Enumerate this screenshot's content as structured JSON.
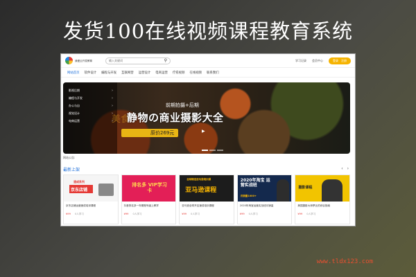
{
  "headline": "发货100在线视频课程教育系统",
  "header": {
    "logo_text": "我爱云开发教育",
    "search_placeholder": "输入关键词",
    "links": [
      "学习记录",
      "会员中心"
    ],
    "pill_buttons": [
      "登录",
      "注册"
    ]
  },
  "nav": {
    "items": [
      "网站首页",
      "软件设计",
      "编程与开发",
      "互联网营",
      "运营设计",
      "电商运营",
      "疗愈视频",
      "在线视频",
      "联系我们"
    ]
  },
  "banner": {
    "categories": [
      "影视后期",
      "编程与开发",
      "办公与自",
      "视觉设计",
      "电商运营"
    ],
    "subtitle": "前期拍摄+后期",
    "bg_word": "美食",
    "title": "静物の商业摄影大全",
    "price": "原价269元",
    "play": "▶"
  },
  "notice_label": "网站公告:",
  "section": {
    "title": "最新上架",
    "prev": "‹",
    "next": "›"
  },
  "courses": [
    {
      "thumb_text": "京东店铺",
      "thumb_sub": "速成系列",
      "title": "京东店铺运营速成培训课程",
      "price": "¥99",
      "learners": "0人学习",
      "bg": "#f5f5f5",
      "accent": "#e53935"
    },
    {
      "thumb_text": "排名多 VIP学习卡",
      "thumb_sub": "",
      "title": "抖音排名多一年期账号级上教学",
      "price": "¥99",
      "learners": "0人学习",
      "bg": "#e31f57",
      "accent": "#ffd54f"
    },
    {
      "thumb_text": "亚马逊课程",
      "thumb_sub": "全球精选亚马逊培训课",
      "title": "亚马逊全球开店速成培训课程",
      "price": "¥99",
      "learners": "0人学习",
      "bg": "#1c1c1c",
      "accent": "#f5b301"
    },
    {
      "thumb_text": "2020年淘宝 运营实战班",
      "thumb_sub": "月销量1000+",
      "title": "2020年淘宝运营实战班月销量",
      "price": "¥99",
      "learners": "0人学习",
      "bg": "#14294d",
      "accent": "#ffffff"
    },
    {
      "thumb_text": "摄影课程",
      "thumb_sub": "",
      "title": "美国摄影大师罗比的综合指南",
      "price": "¥99",
      "learners": "0人学习",
      "bg": "#f2c400",
      "accent": "#222222"
    }
  ],
  "watermark": "www.tldx123.com",
  "colors": {
    "brand_blue": "#1e6fd9",
    "price_red": "#e53935",
    "pill_yellow": "#f5b301"
  }
}
